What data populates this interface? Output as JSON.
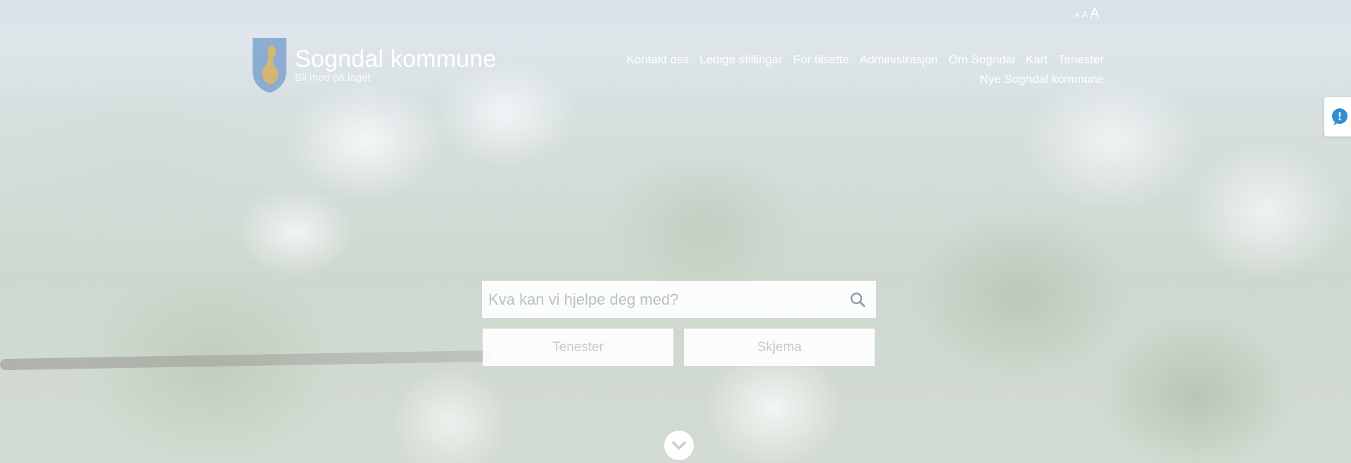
{
  "font_size_controls": [
    "A",
    "A",
    "A"
  ],
  "header": {
    "logo_name": "Sogndal kommune",
    "logo_tagline": "Bli med på laget",
    "nav": [
      "Kontakt oss",
      "Ledige stillingar",
      "For tilsette",
      "Administrasjon",
      "Om Sogndal",
      "Kart",
      "Tenester",
      "Nye Sogndal kommune"
    ]
  },
  "search": {
    "placeholder": "Kva kan vi hjelpe deg med?",
    "icon": "search-icon"
  },
  "quick_buttons": {
    "tenester": "Tenester",
    "skjema": "Skjema"
  },
  "icons": {
    "side_tab": "help-chat-icon",
    "scroll": "chevron-down-icon",
    "logo": "municipal-crest-icon"
  },
  "colors": {
    "crest_blue": "#4a7fbf",
    "crest_gold": "#e9b85a",
    "accent": "#2d8fd5",
    "muted_icon": "#8f9aa2"
  }
}
